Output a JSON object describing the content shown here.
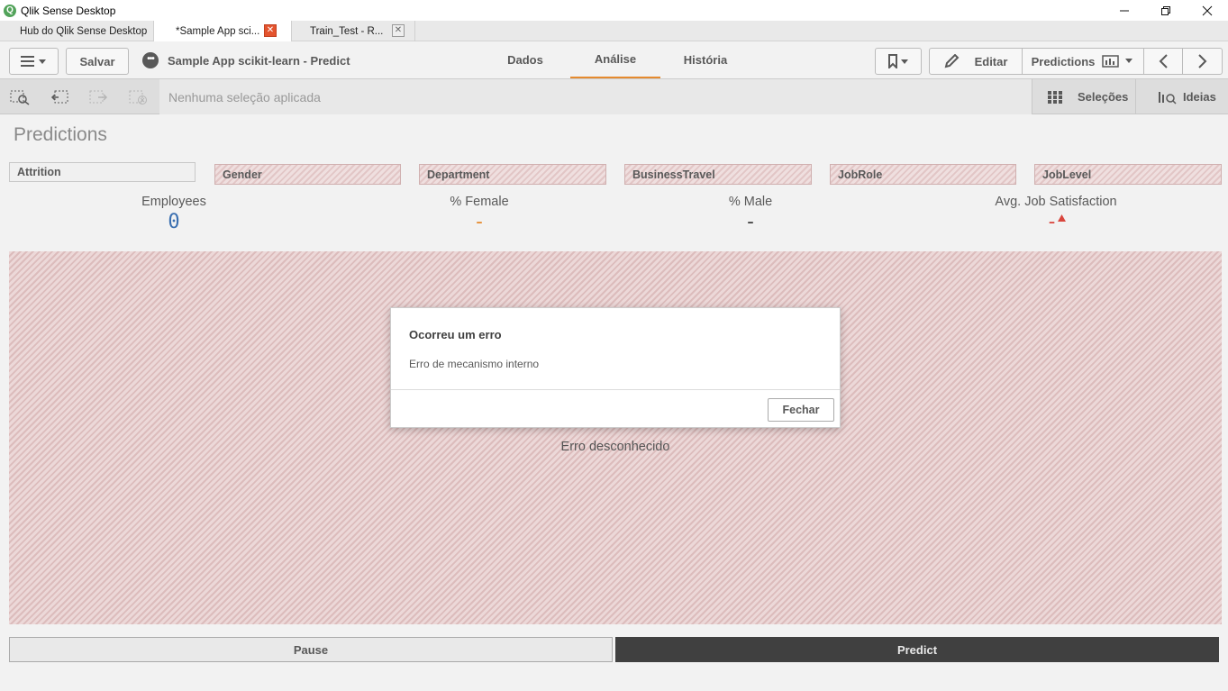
{
  "window": {
    "title": "Qlik Sense Desktop",
    "icon": "qlik-icon",
    "buttons": {
      "minimize": "—",
      "restore": "❐",
      "close": "✕"
    }
  },
  "tabs": [
    {
      "label": "Hub do Qlik Sense Desktop"
    },
    {
      "label": "*Sample App sci...",
      "close": "✕"
    },
    {
      "label": "Train_Test - R...",
      "close": "✕"
    }
  ],
  "toolbar": {
    "menu_icon": "☰ ▾",
    "save_label": "Salvar",
    "app_title": "Sample App scikit-learn - Predict",
    "nav": {
      "data": "Dados",
      "analysis": "Análise",
      "story": "História"
    },
    "bookmark_icon": "bookmark-icon",
    "edit_label": "Editar",
    "sheet_label": "Predictions",
    "prev_icon": "‹",
    "next_icon": "›"
  },
  "selection_bar": {
    "placeholder": "Nenhuma seleção aplicada",
    "selections_label": "Seleções",
    "insights_label": "Ideias"
  },
  "sheet": {
    "title": "Predictions",
    "filters": [
      "Attrition",
      "Gender",
      "Department",
      "BusinessTravel",
      "JobRole",
      "JobLevel"
    ],
    "kpis": [
      {
        "label": "Employees",
        "value": "0",
        "color": "#3a6fb0"
      },
      {
        "label": "% Female",
        "value": "-",
        "color": "#e58a2e"
      },
      {
        "label": "% Male",
        "value": "-",
        "color": "#404040"
      },
      {
        "label": "Avg. Job Satisfaction",
        "value": "-",
        "color": "#d9453d"
      }
    ],
    "chart_error": "Erro desconhecido",
    "pause_label": "Pause",
    "predict_label": "Predict"
  },
  "dialog": {
    "title": "Ocorreu um erro",
    "message": "Erro de mecanismo interno",
    "close_label": "Fechar"
  },
  "colors": {
    "accent": "#e58a2e",
    "predict_bg": "#404040",
    "error_close": "#e4542e"
  }
}
